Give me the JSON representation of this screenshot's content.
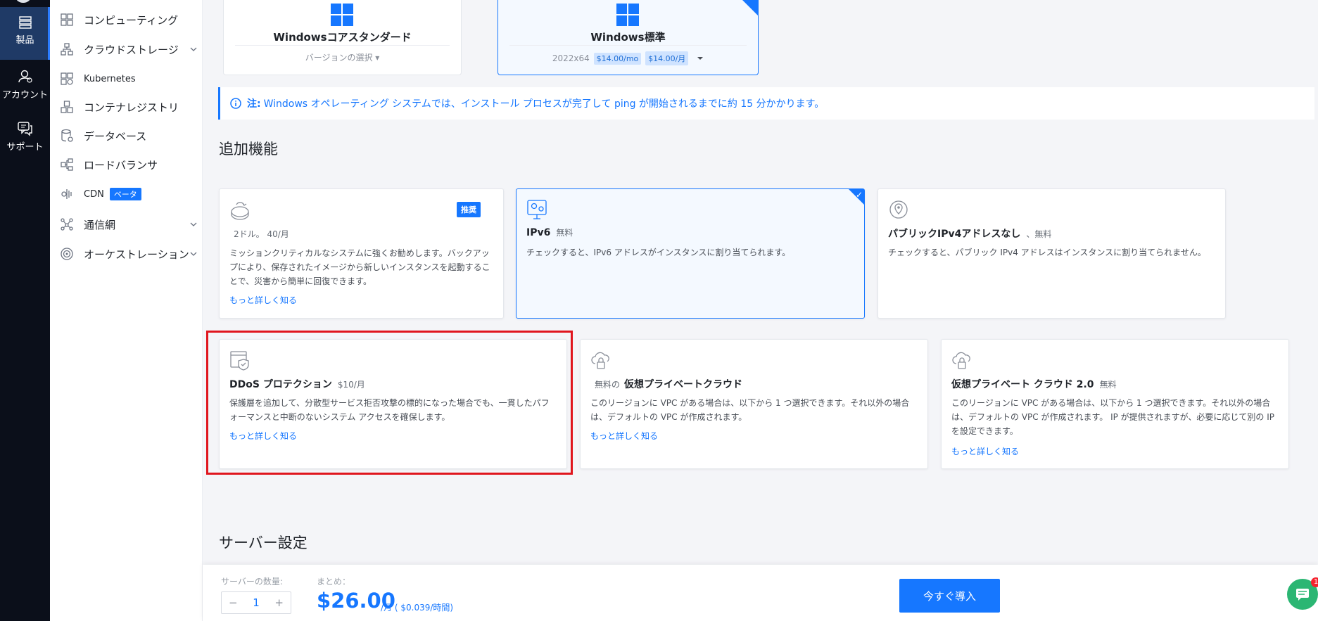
{
  "rail": {
    "items": [
      {
        "label": "製品",
        "icon": "server-stack-icon"
      },
      {
        "label": "アカウント",
        "icon": "user-icon"
      },
      {
        "label": "サポート",
        "icon": "chat-support-icon"
      }
    ]
  },
  "menu": {
    "items": [
      {
        "label": "コンピューティング",
        "icon": "compute-icon",
        "has_children": false
      },
      {
        "label": "クラウドストレージ",
        "icon": "storage-icon",
        "has_children": true
      },
      {
        "label": "Kubernetes",
        "icon": "kubernetes-icon",
        "has_children": false
      },
      {
        "label": "コンテナレジストリ",
        "icon": "container-registry-icon",
        "has_children": false
      },
      {
        "label": "データベース",
        "icon": "database-icon",
        "has_children": false
      },
      {
        "label": "ロードバランサ",
        "icon": "load-balancer-icon",
        "has_children": false
      },
      {
        "label": "CDN",
        "icon": "cdn-icon",
        "has_children": false,
        "badge": "ベータ"
      },
      {
        "label": "通信網",
        "icon": "network-icon",
        "has_children": true
      },
      {
        "label": "オーケストレーション",
        "icon": "orchestration-icon",
        "has_children": true
      }
    ]
  },
  "os_cards": [
    {
      "title": "Windowsコアスタンダード",
      "sub": "バージョンの選択 ▾",
      "selected": false
    },
    {
      "title": "Windows標準",
      "version": "2022x64",
      "price_mo": "$14.00/mo",
      "price_month": "$14.00/月",
      "selected": true
    }
  ],
  "notice": {
    "prefix": "注:",
    "text": "Windows オペレーティング システムでは、インストール プロセスが完了して ping が開始されるまでに約 15 分かかります。"
  },
  "additional": {
    "title": "追加機能",
    "features": [
      {
        "id": "backup",
        "name": "",
        "price": "2ドル。 40/月",
        "desc": "ミッションクリティカルなシステムに強くお勧めします。バックアップにより、保存されたイメージから新しいインスタンスを起動することで、災害から簡単に回復できます。",
        "link": "もっと詳しく知る",
        "badge": "推奨",
        "selected": false
      },
      {
        "id": "ipv6",
        "name": "IPv6",
        "price": "無料",
        "desc": "チェックすると、IPv6 アドレスがインスタンスに割り当てられます。",
        "link": "",
        "selected": true
      },
      {
        "id": "no-ipv4",
        "name": "パブリックIPv4アドレスなし",
        "price": "、無料",
        "desc": "チェックすると、パブリック IPv4 アドレスはインスタンスに割り当てられません。",
        "link": "",
        "selected": false
      },
      {
        "id": "ddos",
        "name": "DDoS プロテクション",
        "price": "$10/月",
        "desc": "保護層を追加して、分散型サービス拒否攻撃の標的になった場合でも、一貫したパフォーマンスと中断のないシステム アクセスを確保します。",
        "link": "もっと詳しく知る",
        "selected": false
      },
      {
        "id": "vpc",
        "name_prefix": "無料の",
        "name": "仮想プライベートクラウド",
        "price": "",
        "desc": "このリージョンに VPC がある場合は、以下から 1 つ選択できます。それ以外の場合は、デフォルトの VPC が作成されます。",
        "link": "もっと詳しく知る",
        "selected": false
      },
      {
        "id": "vpc2",
        "name": "仮想プライベート クラウド 2.0",
        "price": "無料",
        "desc": "このリージョンに VPC がある場合は、以下から 1 つ選択できます。それ以外の場合は、デフォルトの VPC が作成されます。 IP が提供されますが、必要に応じて別の IP を設定できます。",
        "link": "もっと詳しく知る",
        "selected": false
      }
    ]
  },
  "server_settings": {
    "title": "サーバー設定"
  },
  "bottom": {
    "qty_label": "サーバーの数量:",
    "qty_value": "1",
    "minus": "−",
    "plus": "+",
    "summary_label": "まとめ：",
    "price": "$26.00",
    "price_unit": "/月 ( $0.039/時間)",
    "deploy": "今すぐ導入",
    "chat_badge": "1"
  },
  "colors": {
    "accent": "#1677ff",
    "highlight": "#e0161e",
    "rail_bg": "#0b0f1a",
    "chat": "#2bb673"
  }
}
